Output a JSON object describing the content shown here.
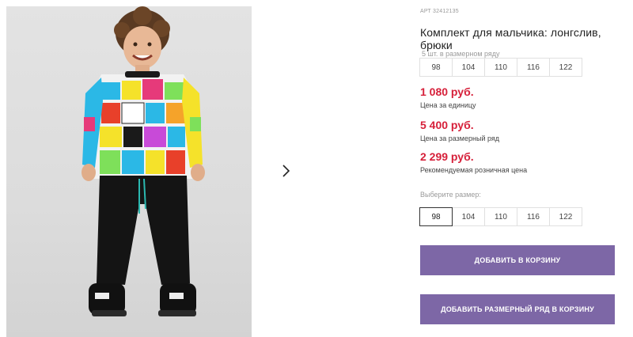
{
  "product": {
    "article": "АРТ 32412135",
    "title": "Комплект для мальчика: лонгслив, брюки",
    "size_row_caption": "5 шт. в размерном ряду",
    "size_row": [
      "98",
      "104",
      "110",
      "116",
      "122"
    ]
  },
  "prices": [
    {
      "value": "1 080 руб.",
      "caption": "Цена за единицу"
    },
    {
      "value": "5 400 руб.",
      "caption": "Цена за размерный ряд"
    },
    {
      "value": "2 299 руб.",
      "caption": "Рекомендуемая розничная цена"
    }
  ],
  "size_picker": {
    "label": "Выберите размер:",
    "sizes": [
      "98",
      "104",
      "110",
      "116",
      "122"
    ],
    "selected": "98"
  },
  "buttons": {
    "add_to_cart": "ДОБАВИТЬ В КОРЗИНУ",
    "add_size_row": "ДОБАВИТЬ РАЗМЕРНЫЙ РЯД В КОРЗИНУ"
  },
  "gallery": {
    "next_icon": "chevron-right-icon"
  },
  "colors": {
    "price": "#d6203a",
    "button": "#7d67a6",
    "photo_bg": "#dcdcdc"
  }
}
